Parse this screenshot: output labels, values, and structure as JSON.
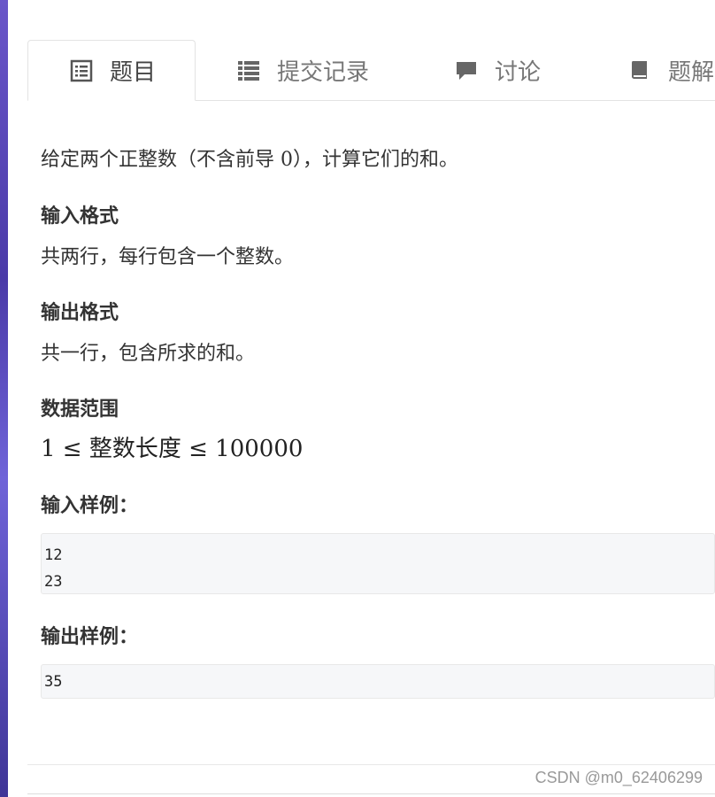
{
  "tabs": [
    {
      "label": "题目",
      "icon": "list-alt-icon",
      "active": true
    },
    {
      "label": "提交记录",
      "icon": "list-icon",
      "active": false
    },
    {
      "label": "讨论",
      "icon": "comment-icon",
      "active": false
    },
    {
      "label": "题解",
      "icon": "book-icon",
      "active": false
    }
  ],
  "problem": {
    "description": "给定两个正整数（不含前导 0），计算它们的和。",
    "input_format_title": "输入格式",
    "input_format_text": "共两行，每行包含一个整数。",
    "output_format_title": "输出格式",
    "output_format_text": "共一行，包含所求的和。",
    "range_title": "数据范围",
    "range_text": "1 ≤ 整数长度 ≤ 100000",
    "sample_input_title": "输入样例：",
    "sample_input": "12\n23",
    "sample_output_title": "输出样例：",
    "sample_output": "35"
  },
  "watermark": "CSDN @m0_62406299",
  "colors": {
    "text": "#333333",
    "tab_inactive": "#777777",
    "code_bg": "#f6f7f9"
  }
}
